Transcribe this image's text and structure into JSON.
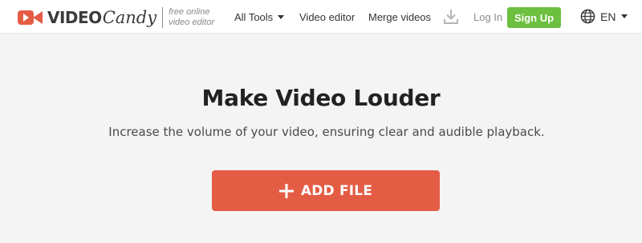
{
  "header": {
    "logo": {
      "word_video": "VIDEO",
      "word_candy": "Candy",
      "tagline_line1": "free online",
      "tagline_line2": "video editor"
    },
    "nav": {
      "all_tools": "All Tools",
      "video_editor": "Video editor",
      "merge_videos": "Merge videos"
    },
    "download_icon": "download-icon",
    "login": "Log In",
    "signup": "Sign Up",
    "language": "EN"
  },
  "main": {
    "title": "Make Video Louder",
    "subtitle": "Increase the volume of your video, ensuring clear and audible playback.",
    "add_file": "ADD FILE"
  },
  "colors": {
    "brand": "#e45c44",
    "signup": "#6cbf3f",
    "background": "#f4f4f4"
  }
}
